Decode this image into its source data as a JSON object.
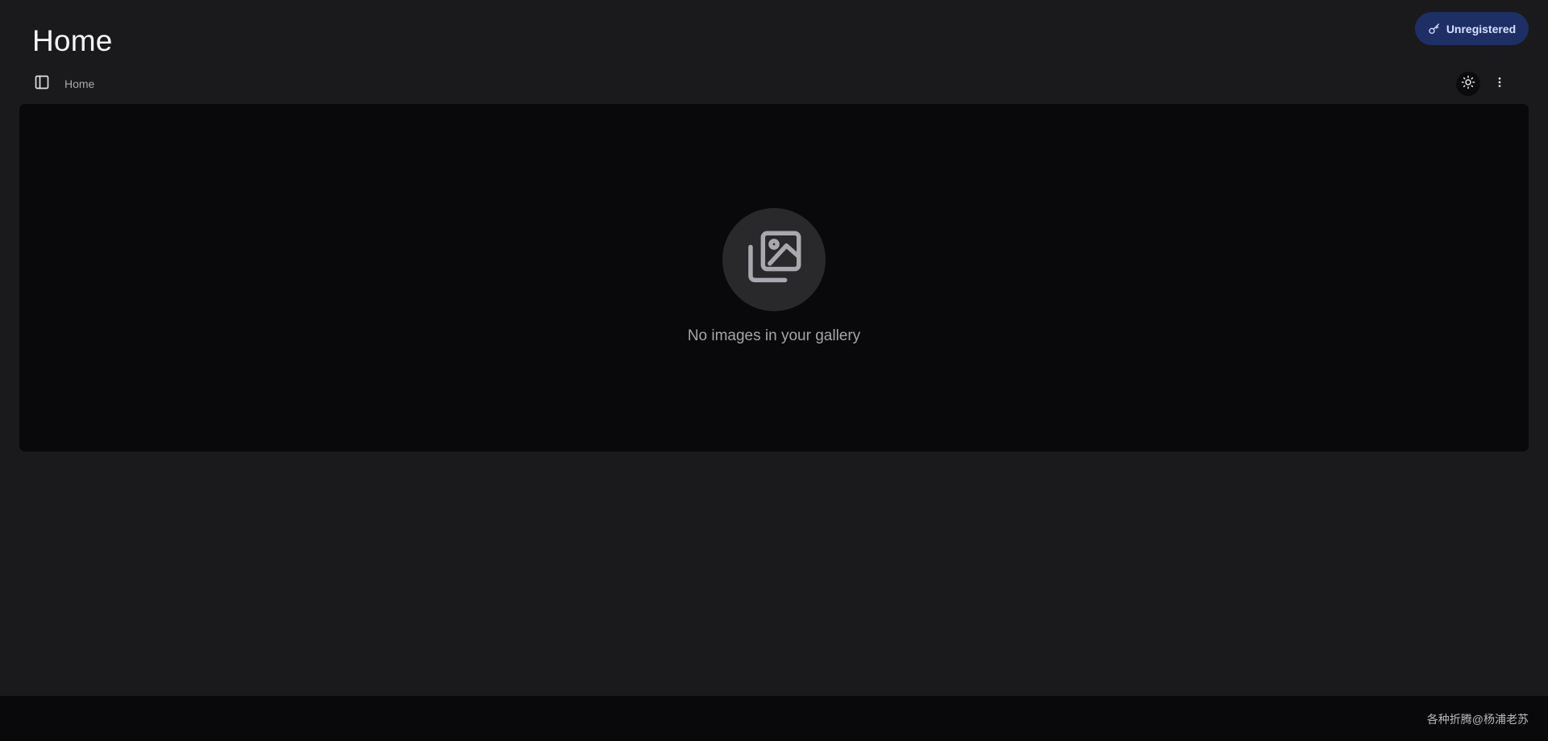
{
  "page": {
    "title": "Home"
  },
  "header": {
    "register_button_label": "Unregistered"
  },
  "breadcrumb": {
    "current": "Home"
  },
  "toolbar": {
    "sidebar_toggle_icon": "sidebar-panel-icon",
    "theme_toggle_icon": "sun-icon",
    "more_icon": "vertical-dots-icon"
  },
  "gallery": {
    "empty_icon": "image-stack-icon",
    "empty_message": "No images in your gallery"
  },
  "footer": {
    "watermark": "各种折腾@杨浦老苏"
  },
  "colors": {
    "background": "#1a1a1c",
    "panel": "#09090b",
    "register_bg": "#1e2f66",
    "register_text": "#d7e0ff",
    "muted_text": "#a4a4aa"
  }
}
